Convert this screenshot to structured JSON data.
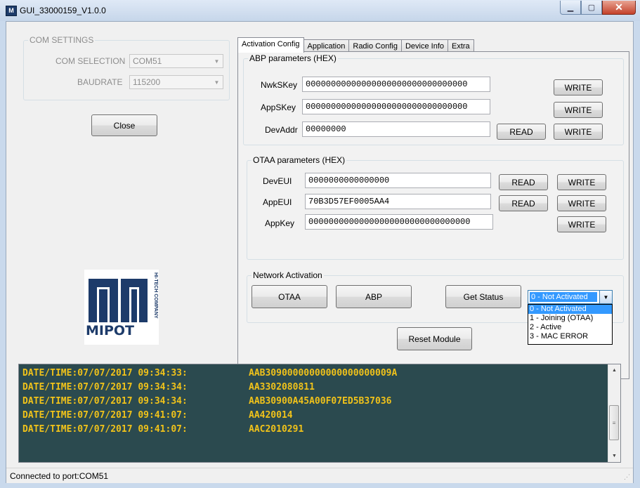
{
  "window": {
    "title": "GUI_33000159_V1.0.0",
    "icon_text": "M",
    "min_symbol": "▁",
    "max_symbol": "▢",
    "close_symbol": "✕"
  },
  "com_settings": {
    "group_label": "COM SETTINGS",
    "com_selection_label": "COM SELECTION",
    "com_selection_value": "COM51",
    "baudrate_label": "BAUDRATE",
    "baudrate_value": "115200",
    "close_button": "Close"
  },
  "tabs": [
    "Activation Config",
    "Application",
    "Radio Config",
    "Device Info",
    "Extra"
  ],
  "active_tab": "Activation Config",
  "abp": {
    "group_label": "ABP parameters (HEX)",
    "nwkskey_label": "NwkSKey",
    "nwkskey_value": "00000000000000000000000000000000",
    "appskey_label": "AppSKey",
    "appskey_value": "00000000000000000000000000000000",
    "devaddr_label": "DevAddr",
    "devaddr_value": "00000000",
    "read_label": "READ",
    "write_label": "WRITE"
  },
  "otaa": {
    "group_label": "OTAA parameters (HEX)",
    "deveui_label": "DevEUI",
    "deveui_value": "0000000000000000",
    "appeui_label": "AppEUI",
    "appeui_value": "70B3D57EF0005AA4",
    "appkey_label": "AppKey",
    "appkey_value": "00000000000000000000000000000000",
    "read_label": "READ",
    "write_label": "WRITE"
  },
  "network_activation": {
    "group_label": "Network Activation",
    "otaa_button": "OTAA",
    "abp_button": "ABP",
    "get_status_button": "Get Status",
    "status_selected": "0 - Not Activated",
    "status_options": [
      "0 - Not Activated",
      "1 - Joining (OTAA)",
      "2 - Active",
      "3 - MAC ERROR"
    ]
  },
  "reset_button": "Reset Module",
  "logo": {
    "text": "MIPOT",
    "tagline": "HI-TECH COMPANY",
    "color": "#1d3b6a"
  },
  "log": [
    {
      "time": "DATE/TIME:07/07/2017 09:34:33:",
      "msg": "AAB30900000000000000000009A"
    },
    {
      "time": "DATE/TIME:07/07/2017 09:34:34:",
      "msg": "AA3302080811"
    },
    {
      "time": "DATE/TIME:07/07/2017 09:34:34:",
      "msg": "AAB30900A45A00F07ED5B37036"
    },
    {
      "time": "DATE/TIME:07/07/2017 09:41:07:",
      "msg": "AA420014"
    },
    {
      "time": "DATE/TIME:07/07/2017 09:41:07:",
      "msg": "AAC2010291"
    }
  ],
  "status_bar": "Connected to port:COM51",
  "colors": {
    "log_bg": "#2b4a4f",
    "log_text": "#f0c21a",
    "selection": "#3399ff"
  }
}
